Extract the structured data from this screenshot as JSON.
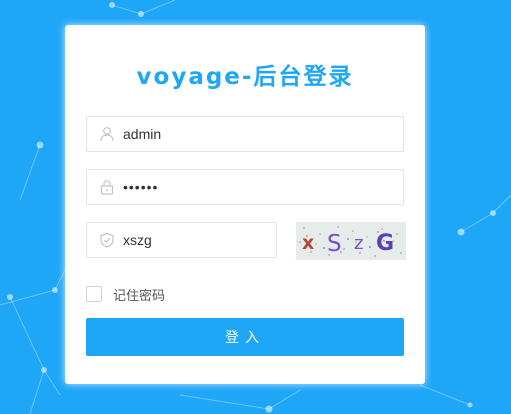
{
  "login": {
    "title": "voyage-后台登录",
    "username": {
      "value": "admin",
      "icon": "user-icon"
    },
    "password": {
      "value": "••••••",
      "icon": "lock-icon"
    },
    "captcha": {
      "value": "xszg",
      "icon": "shield-icon",
      "image_text": "xSzG"
    },
    "remember_label": "记住密码",
    "remember_checked": false,
    "submit_label": "登入"
  },
  "colors": {
    "background": "#1ea6f7",
    "accent": "#1ea6f7",
    "card": "#ffffff"
  }
}
